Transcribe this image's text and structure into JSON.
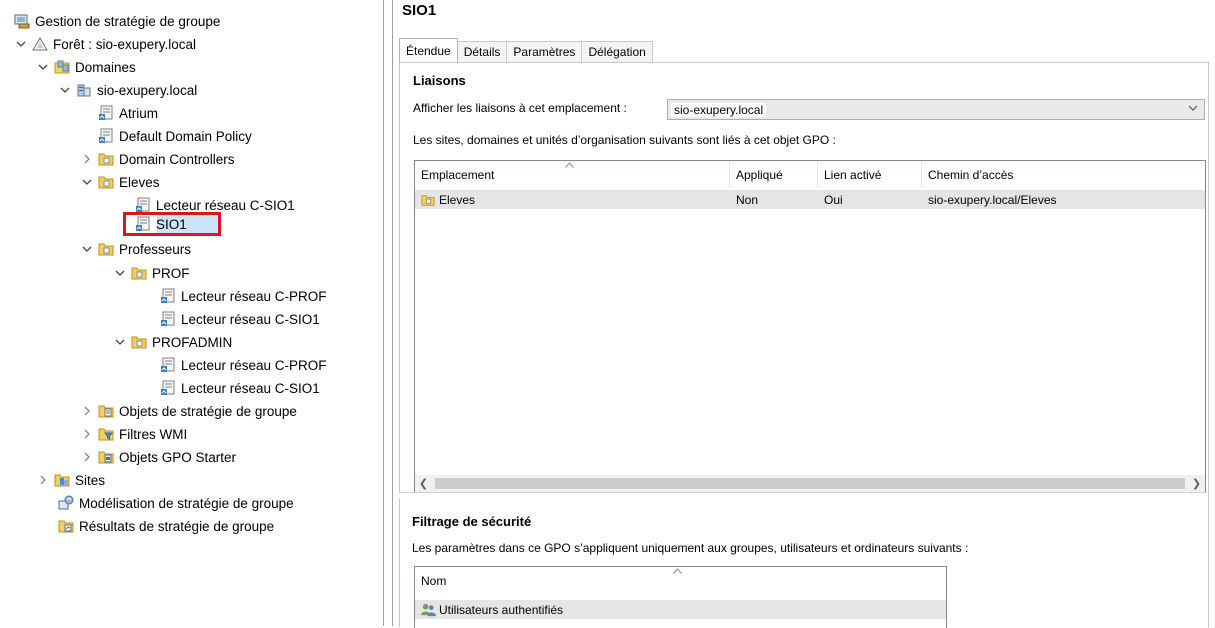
{
  "tree": {
    "root_label": "Gestion de stratégie de groupe",
    "forest_label": "Forêt : sio-exupery.local",
    "domains_label": "Domaines",
    "domain_label": "sio-exupery.local",
    "atrium_label": "Atrium",
    "default_policy_label": "Default Domain Policy",
    "domain_controllers_label": "Domain Controllers",
    "eleves_label": "Eleves",
    "eleves_gpo1_label": "Lecteur réseau C-SIO1",
    "eleves_gpo2_label": "SIO1",
    "professeurs_label": "Professeurs",
    "prof_label": "PROF",
    "prof_gpo1_label": "Lecteur réseau C-PROF",
    "prof_gpo2_label": "Lecteur réseau C-SIO1",
    "profadmin_label": "PROFADMIN",
    "profadmin_gpo1_label": "Lecteur réseau C-PROF",
    "profadmin_gpo2_label": "Lecteur réseau C-SIO1",
    "gpo_objects_label": "Objets de stratégie de groupe",
    "wmi_label": "Filtres WMI",
    "starter_label": "Objets GPO Starter",
    "sites_label": "Sites",
    "modeling_label": "Modélisation de stratégie de groupe",
    "results_label": "Résultats de stratégie de groupe"
  },
  "details": {
    "title": "SIO1",
    "tabs": [
      "Étendue",
      "Détails",
      "Paramètres",
      "Délégation"
    ],
    "links_heading": "Liaisons",
    "location_prompt": "Afficher les liaisons à cet emplacement :",
    "location_value": "sio-exupery.local",
    "links_description": "Les sites, domaines et unités d’organisation suivants sont liés à cet objet GPO :",
    "links_columns": [
      "Emplacement",
      "Appliqué",
      "Lien activé",
      "Chemin d’accès"
    ],
    "links_rows": [
      {
        "location": "Eleves",
        "enforced": "Non",
        "enabled": "Oui",
        "path": "sio-exupery.local/Eleves"
      }
    ],
    "security_heading": "Filtrage de sécurité",
    "security_description": "Les paramètres dans ce GPO s’appliquent uniquement aux groupes, utilisateurs et ordinateurs suivants :",
    "security_column": "Nom",
    "security_rows": [
      "Utilisateurs authentifiés"
    ]
  },
  "colors": {
    "highlight_border": "#e0141e",
    "selection": "#cce4f7",
    "row_highlight": "#e5e5e5"
  }
}
